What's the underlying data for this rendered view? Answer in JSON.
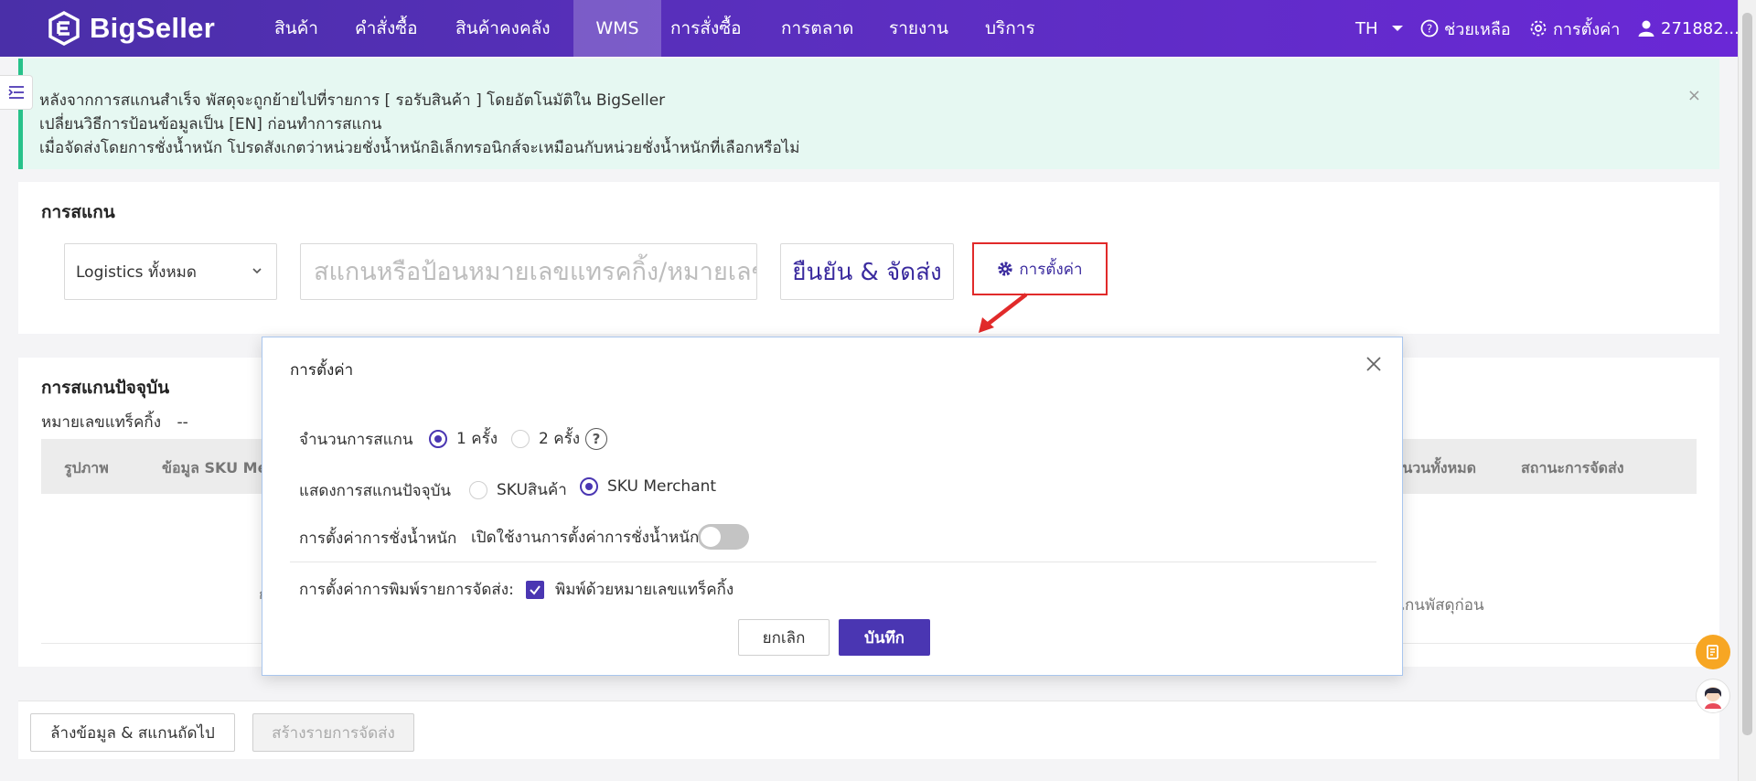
{
  "nav": {
    "brand": "BigSeller",
    "items": [
      "สินค้า",
      "คำสั่งซื้อ",
      "สินค้าคงคลัง",
      "WMS",
      "การสั่งซื้อ",
      "การตลาด",
      "รายงาน",
      "บริการ"
    ],
    "active_index": 3,
    "lang": "TH",
    "help": "ช่วยเหลือ",
    "settings": "การตั้งค่า",
    "user": "271882..."
  },
  "alert": {
    "lines": [
      "หลังจากการสแกนสำเร็จ พัสดุจะถูกย้ายไปที่รายการ [ รอรับสินค้า ] โดยอัตโนมัติใน BigSeller",
      "เปลี่ยนวิธีการป้อนข้อมูลเป็น [EN] ก่อนทำการสแกน",
      "เมื่อจัดส่งโดยการชั่งน้ำหนัก โปรดสังเกตว่าหน่วยชั่งน้ำหนักอิเล็กทรอนิกส์จะเหมือนกับหน่วยชั่งน้ำหนักที่เลือกหรือไม่"
    ],
    "close": "×"
  },
  "scan": {
    "title": "การสแกน",
    "logistics_select": "Logistics ทั้งหมด",
    "input_placeholder": "สแกนหรือป้อนหมายเลขแทรคกิ้ง/หมายเลขพัสดุ",
    "confirm_button": "ยืนยัน & จัดส่ง",
    "settings_button": "การตั้งค่า"
  },
  "current": {
    "title": "การสแกนปัจจุบัน",
    "tracking_label": "หมายเลขแทร็คกิ้ง",
    "tracking_value": "--",
    "columns": [
      "รูปภาพ",
      "ข้อมูล SKU Merchant",
      "จำนวนทั้งหมด",
      "สถานะการจัดส่ง"
    ],
    "empty_hint_prefix": "ก",
    "empty_hint": "แกนพัสดุก่อน"
  },
  "bottom": {
    "clear_button": "ล้างข้อมูล & สแกนถัดไป",
    "create_button": "สร้างรายการจัดส่ง"
  },
  "modal": {
    "title": "การตั้งค่า",
    "scan_count_label": "จำนวนการสแกน",
    "scan_count_options": [
      "1 ครั้ง",
      "2 ครั้ง"
    ],
    "scan_count_selected": 0,
    "display_label": "แสดงการสแกนปัจจุบัน",
    "display_options": [
      "SKUสินค้า",
      "SKU Merchant"
    ],
    "display_selected": 1,
    "weight_label": "การตั้งค่าการชั่งน้ำหนัก",
    "weight_toggle_text": "เปิดใช้งานการตั้งค่าการชั่งน้ำหนัก",
    "weight_enabled": false,
    "print_label": "การตั้งค่าการพิมพ์รายการจัดส่ง:",
    "print_option": "พิมพ์ด้วยหมายเลขแทร็คกิ้ง",
    "print_checked": true,
    "cancel": "ยกเลิก",
    "save": "บันทึก"
  },
  "colors": {
    "brand": "#4a36b2",
    "highlight": "#e12a2a",
    "alert_bg": "#e6f8f2",
    "alert_border": "#27c28a"
  }
}
